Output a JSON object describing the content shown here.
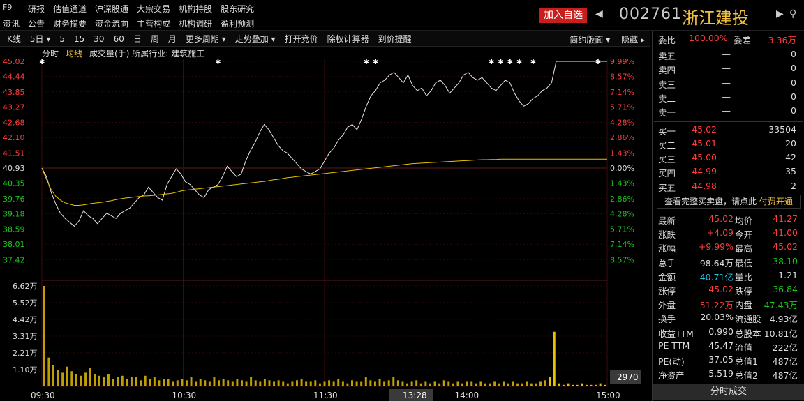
{
  "header": {
    "f9": "F9",
    "menu_row1": [
      "研报",
      "估值通道",
      "沪深股通",
      "大宗交易",
      "机构持股",
      "股东研究"
    ],
    "menu_row2": [
      "资讯",
      "公告",
      "财务摘要",
      "资金流向",
      "主营构成",
      "机构调研",
      "盈利预测"
    ],
    "add_watch": "加入自选",
    "code": "002761",
    "name": "浙江建投",
    "left_arrow": "◀",
    "right_arrow": "▶",
    "search_icon": "⚲"
  },
  "toolbar": {
    "items": [
      "K线",
      "5日 ▾",
      "5",
      "15",
      "30",
      "60",
      "日",
      "周",
      "月",
      "更多周期 ▾",
      "走势叠加 ▾",
      "打开竞价",
      "除权计算器",
      "到价提醒"
    ],
    "right": [
      "简约版面 ▾",
      "隐藏 ▸"
    ]
  },
  "sub": {
    "s1": "分时",
    "s2": "均线",
    "s3": "成交量(手)  所属行业: 建筑施工"
  },
  "chart_data": {
    "type": "line",
    "prev_close": 40.93,
    "price_ticks": [
      "45.02",
      "44.44",
      "43.85",
      "43.27",
      "42.68",
      "42.10",
      "41.51",
      "40.93",
      "40.35",
      "39.76",
      "39.18",
      "38.59",
      "38.01",
      "37.42"
    ],
    "pct_ticks": [
      "9.99%",
      "8.57%",
      "7.14%",
      "5.71%",
      "4.28%",
      "2.86%",
      "1.43%",
      "0.00%",
      "1.43%",
      "2.86%",
      "4.28%",
      "5.71%",
      "7.14%",
      "8.57%"
    ],
    "vol_ticks": [
      "6.62万",
      "5.52万",
      "4.42万",
      "3.31万",
      "2.21万",
      "1.10万"
    ],
    "time_ticks": [
      "09:30",
      "10:30",
      "11:30",
      "14:00",
      "15:00"
    ],
    "cursor_time": "13:28",
    "vol_readout": "2970",
    "price": [
      40.93,
      40.6,
      40.0,
      39.55,
      39.2,
      39.0,
      38.85,
      38.7,
      38.9,
      39.3,
      39.1,
      39.0,
      38.8,
      39.0,
      39.2,
      39.1,
      39.0,
      39.2,
      39.3,
      39.4,
      39.6,
      39.8,
      39.9,
      40.2,
      40.0,
      39.8,
      39.7,
      40.3,
      40.6,
      40.9,
      40.7,
      40.4,
      40.3,
      40.1,
      39.9,
      39.8,
      40.1,
      40.2,
      40.3,
      40.6,
      41.0,
      40.8,
      40.6,
      40.7,
      41.2,
      41.6,
      41.9,
      42.3,
      42.6,
      42.4,
      42.1,
      41.8,
      41.6,
      41.5,
      41.3,
      41.1,
      40.9,
      40.8,
      40.7,
      40.8,
      40.9,
      41.2,
      41.5,
      41.7,
      42.0,
      42.2,
      42.5,
      42.6,
      42.4,
      42.8,
      43.3,
      43.7,
      43.9,
      44.2,
      44.3,
      44.5,
      44.6,
      44.4,
      44.2,
      44.5,
      44.1,
      43.9,
      44.0,
      43.7,
      43.9,
      44.2,
      44.3,
      44.1,
      43.8,
      44.0,
      44.2,
      44.5,
      44.6,
      44.4,
      44.3,
      44.4,
      44.2,
      44.0,
      43.9,
      44.1,
      44.3,
      44.2,
      43.8,
      43.5,
      43.3,
      43.4,
      43.6,
      43.7,
      43.9,
      44.0,
      44.2,
      45.02,
      45.02,
      45.02,
      45.02,
      45.02,
      45.02,
      45.02,
      45.02,
      45.02,
      45.02,
      45.02,
      45.02
    ],
    "avg": [
      40.93,
      40.5,
      40.1,
      39.85,
      39.7,
      39.6,
      39.55,
      39.5,
      39.5,
      39.52,
      39.55,
      39.58,
      39.6,
      39.62,
      39.65,
      39.68,
      39.72,
      39.75,
      39.78,
      39.8,
      39.82,
      39.84,
      39.86,
      39.87,
      39.88,
      39.9,
      39.92,
      39.94,
      39.96,
      40.0,
      40.05,
      40.08,
      40.1,
      40.12,
      40.14,
      40.16,
      40.18,
      40.2,
      40.22,
      40.24,
      40.26,
      40.28,
      40.3,
      40.32,
      40.34,
      40.36,
      40.38,
      40.4,
      40.42,
      40.45,
      40.48,
      40.5,
      40.53,
      40.56,
      40.58,
      40.6,
      40.62,
      40.64,
      40.66,
      40.68,
      40.7,
      40.72,
      40.74,
      40.76,
      40.78,
      40.8,
      40.82,
      40.84,
      40.86,
      40.88,
      40.9,
      40.92,
      40.94,
      40.96,
      40.98,
      41.0,
      41.02,
      41.04,
      41.06,
      41.08,
      41.1,
      41.11,
      41.12,
      41.13,
      41.14,
      41.15,
      41.16,
      41.17,
      41.18,
      41.19,
      41.2,
      41.21,
      41.22,
      41.23,
      41.24,
      41.25,
      41.25,
      41.26,
      41.26,
      41.27,
      41.27,
      41.27,
      41.27,
      41.27,
      41.27,
      41.27,
      41.27,
      41.27,
      41.27,
      41.27,
      41.27,
      41.27,
      41.27,
      41.27,
      41.27,
      41.27,
      41.27,
      41.27,
      41.27,
      41.27,
      41.27,
      41.27,
      41.27
    ],
    "volume": [
      6.62,
      1.9,
      1.4,
      1.1,
      0.9,
      1.3,
      1.0,
      0.8,
      0.7,
      0.9,
      1.2,
      0.8,
      0.7,
      0.6,
      0.8,
      0.5,
      0.6,
      0.7,
      0.5,
      0.6,
      0.6,
      0.4,
      0.7,
      0.5,
      0.6,
      0.4,
      0.5,
      0.5,
      0.3,
      0.4,
      0.5,
      0.4,
      0.6,
      0.3,
      0.5,
      0.4,
      0.3,
      0.6,
      0.4,
      0.5,
      0.4,
      0.3,
      0.5,
      0.4,
      0.3,
      0.6,
      0.4,
      0.3,
      0.5,
      0.4,
      0.3,
      0.4,
      0.3,
      0.2,
      0.3,
      0.4,
      0.5,
      0.3,
      0.3,
      0.4,
      0.2,
      0.3,
      0.4,
      0.3,
      0.5,
      0.3,
      0.2,
      0.4,
      0.3,
      0.3,
      0.6,
      0.4,
      0.3,
      0.5,
      0.3,
      0.4,
      0.6,
      0.4,
      0.3,
      0.2,
      0.3,
      0.4,
      0.2,
      0.3,
      0.2,
      0.3,
      0.2,
      0.4,
      0.3,
      0.2,
      0.3,
      0.2,
      0.3,
      0.3,
      0.2,
      0.3,
      0.2,
      0.2,
      0.3,
      0.2,
      0.3,
      0.2,
      0.3,
      0.2,
      0.2,
      0.3,
      0.2,
      0.2,
      0.3,
      0.4,
      0.6,
      3.6,
      0.2,
      0.1,
      0.2,
      0.1,
      0.1,
      0.2,
      0.1,
      0.1,
      0.1,
      0.2,
      0.1
    ]
  },
  "panel": {
    "weibi_label": "委比",
    "weibi": "100.00%",
    "weicha_label": "委差",
    "weicha": "3.36万",
    "sell": [
      {
        "l": "卖五",
        "p": "—",
        "v": "0"
      },
      {
        "l": "卖四",
        "p": "—",
        "v": "0"
      },
      {
        "l": "卖三",
        "p": "—",
        "v": "0"
      },
      {
        "l": "卖二",
        "p": "—",
        "v": "0"
      },
      {
        "l": "卖一",
        "p": "—",
        "v": "0"
      }
    ],
    "buy": [
      {
        "l": "买一",
        "p": "45.02",
        "v": "33504"
      },
      {
        "l": "买二",
        "p": "45.01",
        "v": "20"
      },
      {
        "l": "买三",
        "p": "45.00",
        "v": "42"
      },
      {
        "l": "买四",
        "p": "44.99",
        "v": "35"
      },
      {
        "l": "买五",
        "p": "44.98",
        "v": "2"
      }
    ],
    "full_book_prefix": "查看完整买卖盘，请点此",
    "full_book_link": "付费开通",
    "stats": [
      {
        "a": "最新",
        "b": "45.02",
        "bc": "red",
        "c": "均价",
        "d": "41.27",
        "dc": "red"
      },
      {
        "a": "涨跌",
        "b": "+4.09",
        "bc": "red",
        "c": "今开",
        "d": "41.00",
        "dc": "red"
      },
      {
        "a": "涨幅",
        "b": "+9.99%",
        "bc": "red",
        "c": "最高",
        "d": "45.02",
        "dc": "red"
      },
      {
        "a": "总手",
        "b": "98.64万",
        "bc": "wh",
        "c": "最低",
        "d": "38.10",
        "dc": "green"
      },
      {
        "a": "金额",
        "b": "40.71亿",
        "bc": "cyan",
        "c": "量比",
        "d": "1.21",
        "dc": "wh"
      },
      {
        "a": "涨停",
        "b": "45.02",
        "bc": "red",
        "c": "跌停",
        "d": "36.84",
        "dc": "green"
      },
      {
        "a": "外盘",
        "b": "51.22万",
        "bc": "red",
        "c": "内盘",
        "d": "47.43万",
        "dc": "green"
      },
      {
        "a": "换手",
        "b": "20.03%",
        "bc": "wh",
        "c": "流通股",
        "d": "4.93亿",
        "dc": "wh"
      },
      {
        "a": "收益TTM",
        "b": "0.990",
        "bc": "wh",
        "c": "总股本",
        "d": "10.81亿",
        "dc": "wh"
      },
      {
        "a": "PE TTM",
        "b": "45.47",
        "bc": "wh",
        "c": "流值",
        "d": "222亿",
        "dc": "wh"
      },
      {
        "a": "PE(动)",
        "b": "37.05",
        "bc": "wh",
        "c": "总值1",
        "d": "487亿",
        "dc": "wh"
      },
      {
        "a": "净资产",
        "b": "5.519",
        "bc": "wh",
        "c": "总值2",
        "d": "487亿",
        "dc": "wh"
      }
    ],
    "bottom_tab": "分时成交"
  }
}
